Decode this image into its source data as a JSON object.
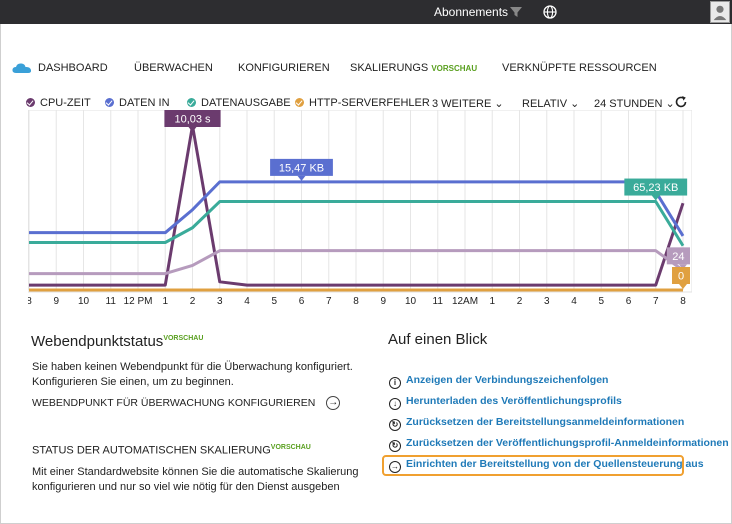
{
  "topbar": {
    "subscriptions": "Abonnements",
    "filter_icon": "filter-icon",
    "globe_icon": "globe-icon",
    "avatar_icon": "avatar-icon"
  },
  "tabs": {
    "dashboard": "DASHBOARD",
    "monitor": "ÜBERWACHEN",
    "configure": "KONFIGURIEREN",
    "scale": "SKALIERUNGS",
    "scale_preview": "VORSCHAU",
    "linked": "VERKNÜPFTE RESSOURCEN"
  },
  "legend": {
    "cpu": "CPU-ZEIT",
    "data_in": "DATEN IN",
    "data_out": "DATENAUSGABE",
    "http_errors": "HTTP-SERVERFEHLER",
    "more": "3 WEITERE",
    "relative": "RELATIV",
    "range": "24 STUNDEN"
  },
  "colors": {
    "cpu": "#6b3b6e",
    "data_in": "#5a6fd0",
    "data_out": "#3aab9a",
    "http_errors": "#e0a040",
    "lavender": "#b69bbd",
    "link": "#1f7ab8",
    "highlight": "#f0a030"
  },
  "chart_data": {
    "type": "line",
    "x": [
      "8",
      "9",
      "10",
      "11",
      "12 PM",
      "1",
      "2",
      "3",
      "4",
      "5",
      "6",
      "7",
      "8",
      "9",
      "10",
      "11",
      "12AM",
      "1",
      "2",
      "3",
      "4",
      "5",
      "6",
      "7",
      "8"
    ],
    "series": [
      {
        "name": "CPU-ZEIT",
        "values": [
          0.3,
          0.3,
          0.3,
          0.3,
          0.3,
          0.3,
          10.03,
          0.5,
          0.3,
          0.3,
          0.3,
          0.3,
          0.3,
          0.3,
          0.3,
          0.3,
          0.3,
          0.3,
          0.3,
          0.3,
          0.3,
          0.3,
          0.3,
          0.3,
          5.3
        ]
      },
      {
        "name": "DATEN IN",
        "values": [
          3.5,
          3.5,
          3.5,
          3.5,
          3.5,
          3.5,
          4.9,
          6.6,
          6.6,
          6.6,
          6.6,
          6.6,
          6.6,
          6.6,
          6.6,
          6.6,
          6.6,
          6.6,
          6.6,
          6.6,
          6.6,
          6.6,
          6.6,
          6.0,
          3.3
        ]
      },
      {
        "name": "DATENAUSGABE",
        "values": [
          2.9,
          2.9,
          2.9,
          2.9,
          2.9,
          2.9,
          3.8,
          5.4,
          5.4,
          5.4,
          5.4,
          5.4,
          5.4,
          5.4,
          5.4,
          5.4,
          5.4,
          5.4,
          5.4,
          5.4,
          5.4,
          5.4,
          5.4,
          5.4,
          2.7
        ]
      },
      {
        "name": "",
        "values": [
          1.0,
          1.0,
          1.0,
          1.0,
          1.0,
          1.0,
          1.5,
          2.4,
          2.4,
          2.4,
          2.4,
          2.4,
          2.4,
          2.4,
          2.4,
          2.4,
          2.4,
          2.4,
          2.4,
          2.4,
          2.4,
          2.4,
          2.4,
          2.4,
          1.2
        ]
      },
      {
        "name": "HTTP-SERVERFEHLER",
        "values": [
          0,
          0,
          0,
          0,
          0,
          0,
          0,
          0,
          0,
          0,
          0,
          0,
          0,
          0,
          0,
          0,
          0,
          0,
          0,
          0,
          0,
          0,
          0,
          0,
          0
        ]
      }
    ],
    "ylim": [
      0,
      10.5
    ],
    "labels": [
      {
        "text": "10,03 s",
        "series": 0,
        "index": 6
      },
      {
        "text": "15,47 KB",
        "series": 1,
        "index": 10
      },
      {
        "text": "65,23 KB",
        "series": 2,
        "index": 23
      },
      {
        "text": "24",
        "series": 3,
        "index": 24
      },
      {
        "text": "0",
        "series": 4,
        "index": 24
      }
    ],
    "grid": true
  },
  "left_panel": {
    "title": "Webendpunktstatus",
    "title_preview": "VORSCHAU",
    "desc1": "Sie haben keinen Webendpunkt für die Überwachung konfiguriert.",
    "desc2": "Konfigurieren Sie einen, um zu beginnen.",
    "configure_link": "WEBENDPUNKT FÜR ÜBERWACHUNG KONFIGURIEREN",
    "autoscale_title": "STATUS DER AUTOMATISCHEN SKALIERUNG",
    "autoscale_preview": "VORSCHAU",
    "autoscale1": "Mit einer Standardwebsite können Sie die automatische Skalierung",
    "autoscale2": "konfigurieren und nur so viel wie nötig für den Dienst ausgeben"
  },
  "right_panel": {
    "title": "Auf einen Blick",
    "links": [
      "Anzeigen der Verbindungszeichenfolgen",
      "Herunterladen des Veröffentlichungsprofils",
      "Zurücksetzen der Bereitstellungsanmeldeinformationen",
      "Zurücksetzen der Veröffentlichungsprofil-Anmeldeinformationen",
      "Einrichten der Bereitstellung von der Quellensteuerung aus"
    ]
  }
}
